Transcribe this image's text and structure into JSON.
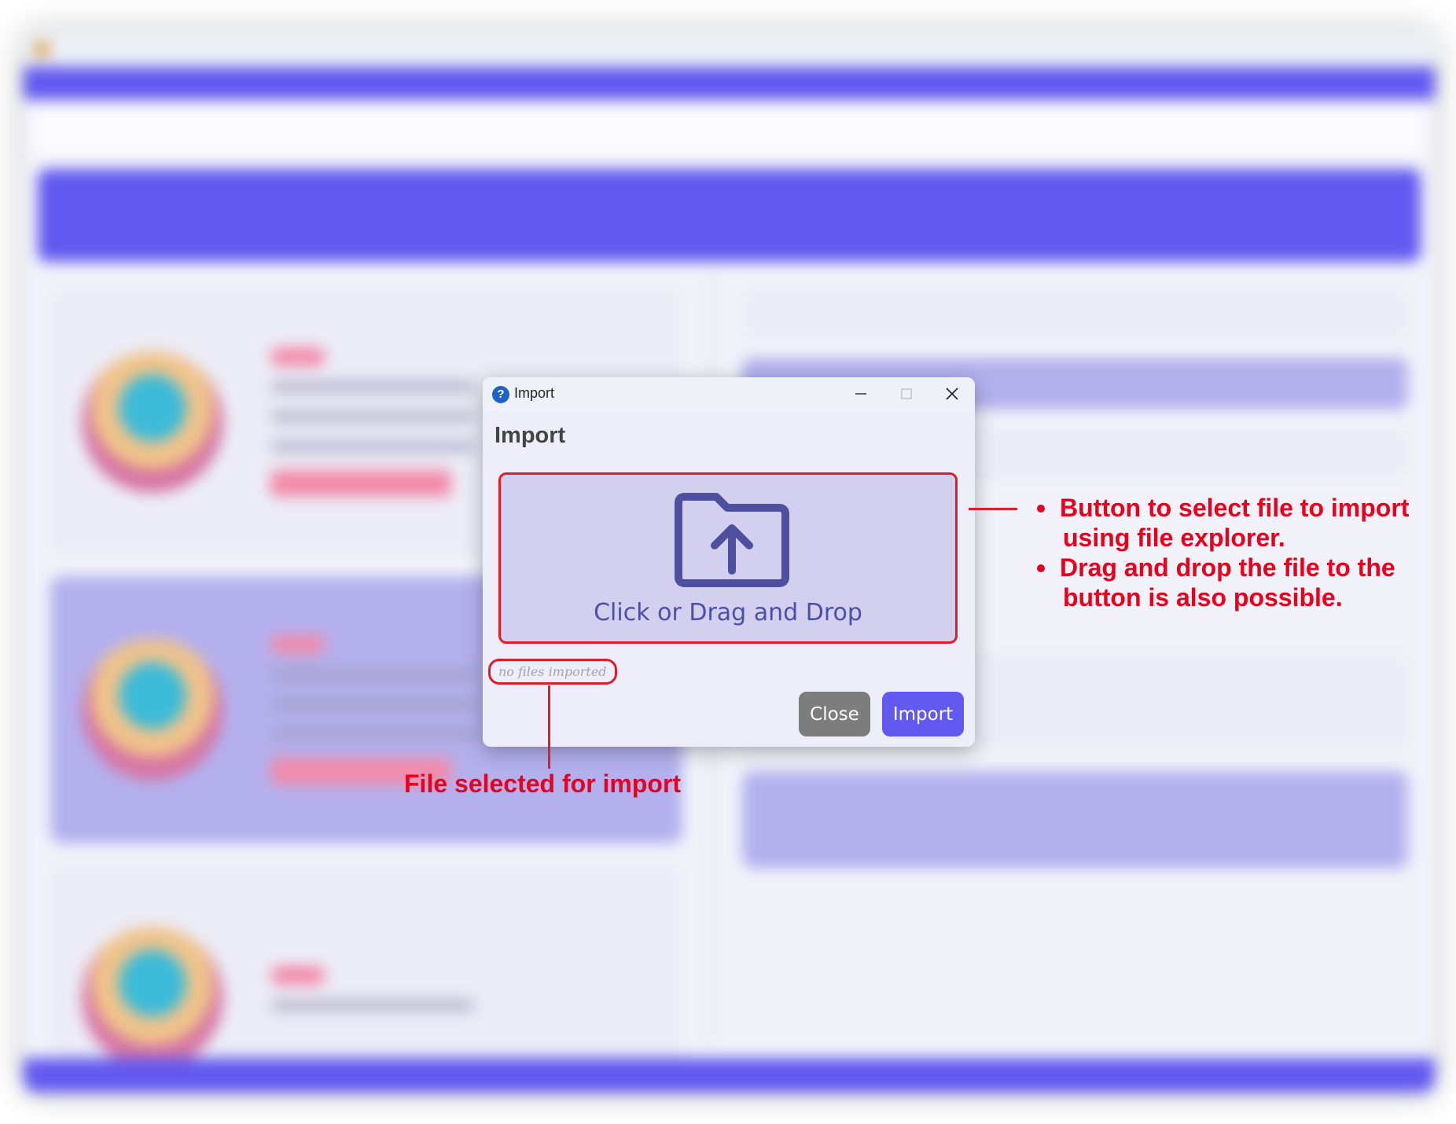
{
  "dialog": {
    "window_title": "Import",
    "header": "Import",
    "dropzone_label": "Click or Drag and Drop",
    "file_status": "no files imported",
    "close_label": "Close",
    "import_label": "Import",
    "app_icon_glyph": "?",
    "dropzone_icon": "folder-upload-icon"
  },
  "annotations": {
    "dropzone_bullets": [
      "Button to select file to import",
      "using file explorer.",
      "Drag and drop the file to the",
      "button is also possible."
    ],
    "file_status_note": "File selected for import"
  },
  "colors": {
    "accent": "#6259f0",
    "annotation_red": "#e8001c",
    "dropzone_bg": "#d2d0ee",
    "dialog_bg": "#eeedfa",
    "close_button_bg": "#7d7d7d"
  }
}
